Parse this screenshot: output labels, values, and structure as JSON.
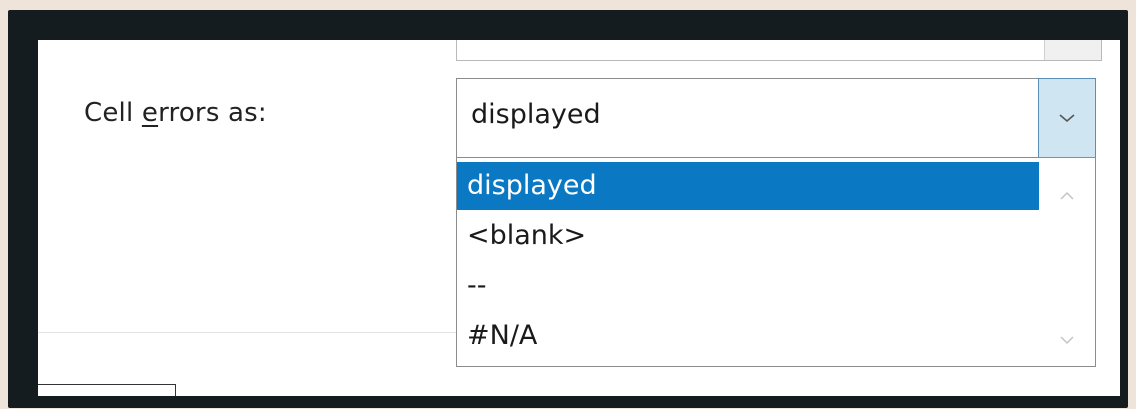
{
  "field": {
    "label_prefix": "Cell ",
    "label_mnemonic": "e",
    "label_suffix": "rrors as:",
    "selected_value": "displayed"
  },
  "dropdown": {
    "options": [
      "displayed",
      "<blank>",
      "--",
      "#N/A"
    ],
    "selected_index": 0
  },
  "icons": {
    "dropdown_arrow": "chevron-down-icon",
    "scroll_up": "chevron-up-icon",
    "scroll_down": "chevron-down-icon"
  },
  "colors": {
    "selection": "#0b78c4",
    "arrow_button": "#cfe5f1"
  }
}
